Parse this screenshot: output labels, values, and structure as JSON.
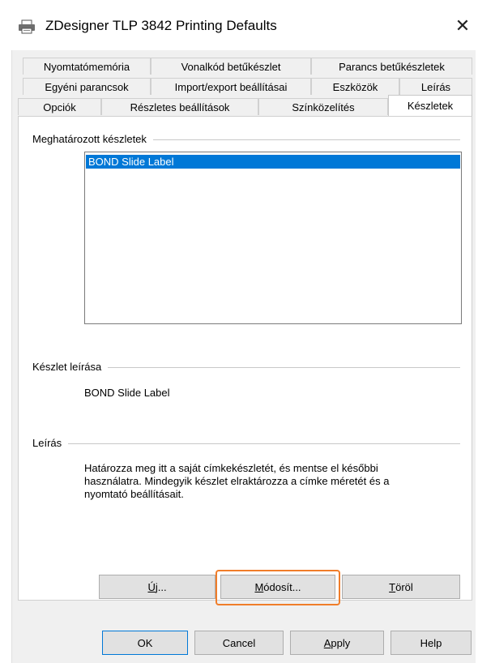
{
  "window": {
    "title": "ZDesigner TLP 3842 Printing Defaults",
    "close_icon": "close-icon",
    "printer_icon": "printer-icon"
  },
  "tabs": {
    "row1": [
      "Nyomtatómemória",
      "Vonalkód betűkészlet",
      "Parancs betűkészletek"
    ],
    "row2": [
      "Egyéni parancsok",
      "Import/export beállításai",
      "Eszközök",
      "Leírás"
    ],
    "row3": [
      "Opciók",
      "Részletes beállítások",
      "Színközelítés",
      "Készletek"
    ],
    "active": "Készletek"
  },
  "groups": {
    "defined_sets_label": "Meghatározott készletek",
    "set_description_label": "Készlet leírása",
    "description_label": "Leírás"
  },
  "listbox": {
    "items": [
      "BOND Slide Label"
    ],
    "selected": "BOND Slide Label"
  },
  "set_description_value": "BOND Slide Label",
  "description_text": [
    "Határozza meg itt a saját címkekészletét, és mentse el későbbi",
    "használatra. Mindegyik készlet elraktározza a címke méretét és a",
    "nyomtató beállításait."
  ],
  "panel_buttons": {
    "new": "Új...",
    "modify": "Módosít...",
    "delete": "Töröl"
  },
  "dialog_buttons": {
    "ok": "OK",
    "cancel": "Cancel",
    "apply": "Apply",
    "help": "Help"
  },
  "colors": {
    "selection": "#0078d7",
    "highlight_box": "#f07d2a"
  }
}
